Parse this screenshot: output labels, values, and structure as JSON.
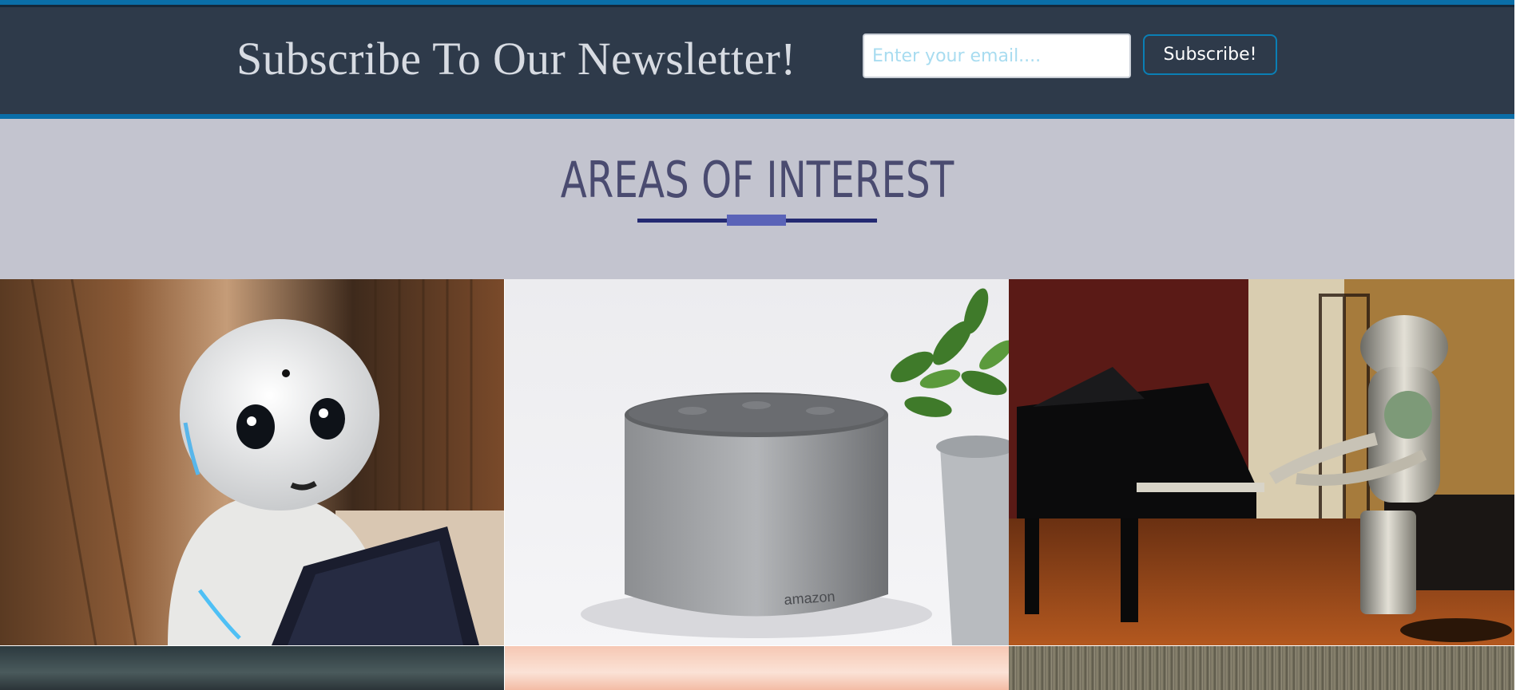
{
  "newsletter": {
    "title": "Subscribe To Our Newsletter!",
    "email_placeholder": "Enter your email....",
    "subscribe_label": "Subscribe!"
  },
  "interest": {
    "title": "AREAS OF INTEREST"
  },
  "tiles": [
    {
      "name": "robot-tablet-image",
      "caption_text": ""
    },
    {
      "name": "smart-speaker-image",
      "brand_text": "amazon"
    },
    {
      "name": "robot-piano-image"
    },
    {
      "name": "sky-image"
    },
    {
      "name": "peach-image"
    },
    {
      "name": "gravel-image"
    }
  ],
  "colors": {
    "bar_bg": "#2e3a4a",
    "bar_border": "#0a6ea8",
    "interest_bg": "#c3c4cf",
    "title_color": "#4a4b70",
    "divider": "#242a72",
    "divider_accent": "#5a63b8"
  }
}
